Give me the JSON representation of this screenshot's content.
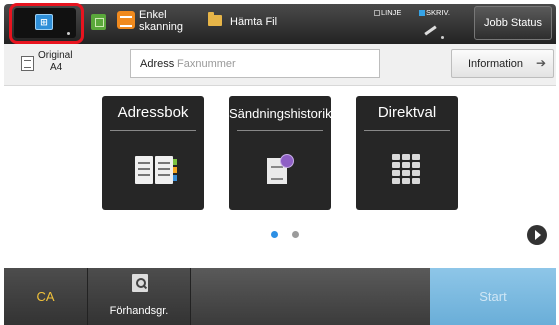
{
  "top_bar": {
    "easy_scan_label": "Enkel skanning",
    "fetch_file_label": "Hämta Fil",
    "status_line_label": "LINJE",
    "status_print_label": "SKRIV.",
    "job_status_label": "Jobb Status",
    "home_icon": "home-icon"
  },
  "original": {
    "label": "Original",
    "size": "A4"
  },
  "address": {
    "label": "Adress",
    "placeholder": "Faxnummer"
  },
  "info_button": {
    "label": "Information",
    "arrow": "➔"
  },
  "tiles": [
    {
      "title": "Adressbok",
      "icon": "address-book-icon"
    },
    {
      "title": "Sändningshistorik",
      "icon": "send-history-icon"
    },
    {
      "title": "Direktval",
      "icon": "keypad-icon"
    }
  ],
  "pagination": {
    "current": 1,
    "total": 2
  },
  "bottom_bar": {
    "ca_label": "CA",
    "preview_label": "Förhandsgr.",
    "start_label": "Start"
  },
  "colors": {
    "accent_blue": "#2c8fe4",
    "ca_yellow": "#f0c13a",
    "start_disabled": "#7ab8df",
    "highlight_red": "#e8141f"
  }
}
